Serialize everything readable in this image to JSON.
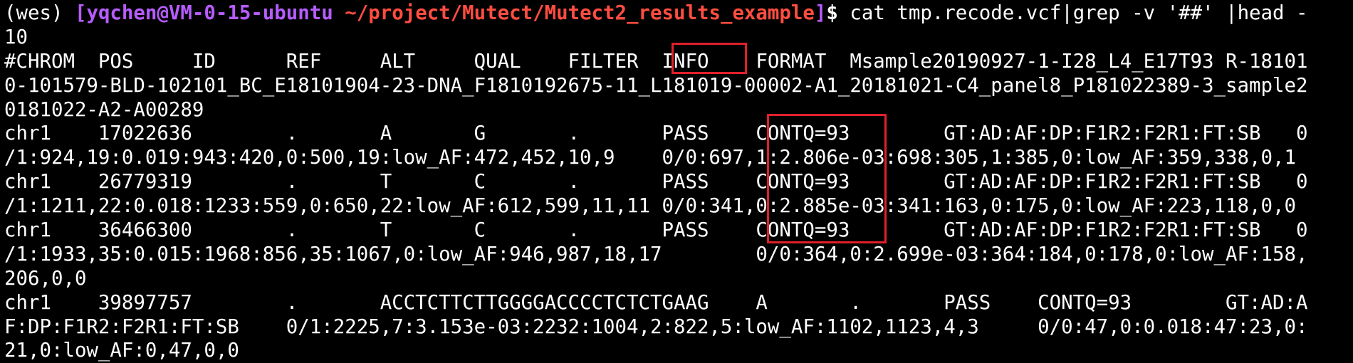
{
  "terminal": {
    "prompt": {
      "env": "(wes) ",
      "open_bracket": "[",
      "user_host": "yqchen@VM-0-15-ubuntu",
      "path": " ~/project/Mutect/Mutect2_results_example",
      "close_bracket": "]",
      "symbol": "$ ",
      "command": "cat tmp.recode.vcf|grep -v '##' |head -"
    },
    "lines": [
      "10",
      "#CHROM  POS     ID      REF     ALT     QUAL    FILTER  INFO    FORMAT  Msample20190927-1-I28_L4_E17T93 R-18101",
      "0-101579-BLD-102101_BC_E18101904-23-DNA_F1810192675-11_L181019-00002-A1_20181021-C4_panel8_P181022389-3_sample2",
      "0181022-A2-A00289",
      "chr1    17022636        .       A       G       .       PASS    CONTQ=93        GT:AD:AF:DP:F1R2:F2R1:FT:SB   0",
      "/1:924,19:0.019:943:420,0:500,19:low_AF:472,452,10,9    0/0:697,1:2.806e-03:698:305,1:385,0:low_AF:359,338,0,1",
      "chr1    26779319        .       T       C       .       PASS    CONTQ=93        GT:AD:AF:DP:F1R2:F2R1:FT:SB   0",
      "/1:1211,22:0.018:1233:559,0:650,22:low_AF:612,599,11,11 0/0:341,0:2.885e-03:341:163,0:175,0:low_AF:223,118,0,0",
      "chr1    36466300        .       T       C       .       PASS    CONTQ=93        GT:AD:AF:DP:F1R2:F2R1:FT:SB   0",
      "/1:1933,35:0.015:1968:856,35:1067,0:low_AF:946,987,18,17        0/0:364,0:2.699e-03:364:184,0:178,0:low_AF:158,",
      "206,0,0",
      "chr1    39897757        .       ACCTCTTCTTGGGGACCCCTCTCTGAAG    A       .       PASS    CONTQ=93        GT:AD:A",
      "F:DP:F1R2:F2R1:FT:SB    0/1:2225,7:3.153e-03:2232:1004,2:822,5:low_AF:1102,1123,4,3     0/0:47,0:0.018:47:23,0:",
      "21,0:low_AF:0,47,0,0"
    ],
    "highlights": [
      "INFO",
      "CONTQ=93"
    ]
  },
  "colors": {
    "background": "#000000",
    "text": "#ffffff",
    "user_host": "#b75cff",
    "path": "#ff4d40",
    "highlight_box": "#e0202a"
  }
}
